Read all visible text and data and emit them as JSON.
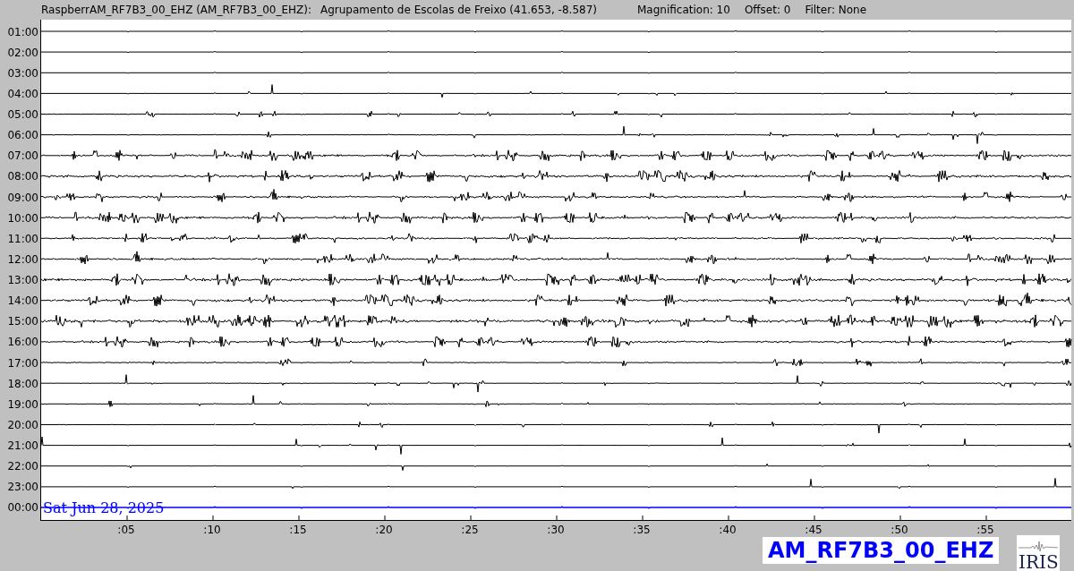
{
  "header": {
    "station": "RaspberrAM_RF7B3_00_EHZ (AM_RF7B3_00_EHZ):",
    "location": "Agrupamento de Escolas de Freixo (41.653, -8.587)",
    "magnification": "Magnification: 10",
    "offset": "Offset: 0",
    "filter": "Filter: None"
  },
  "helicorder": {
    "date": "Sat Jun 28, 2025",
    "rows": [
      {
        "label": "01:00",
        "current": false
      },
      {
        "label": "02:00",
        "current": false
      },
      {
        "label": "03:00",
        "current": false
      },
      {
        "label": "04:00",
        "current": false
      },
      {
        "label": "05:00",
        "current": false
      },
      {
        "label": "06:00",
        "current": false
      },
      {
        "label": "07:00",
        "current": false
      },
      {
        "label": "08:00",
        "current": false
      },
      {
        "label": "09:00",
        "current": false
      },
      {
        "label": "10:00",
        "current": false
      },
      {
        "label": "11:00",
        "current": false
      },
      {
        "label": "12:00",
        "current": false
      },
      {
        "label": "13:00",
        "current": false
      },
      {
        "label": "14:00",
        "current": false
      },
      {
        "label": "15:00",
        "current": false
      },
      {
        "label": "16:00",
        "current": false
      },
      {
        "label": "17:00",
        "current": false
      },
      {
        "label": "18:00",
        "current": false
      },
      {
        "label": "19:00",
        "current": false
      },
      {
        "label": "20:00",
        "current": false
      },
      {
        "label": "21:00",
        "current": false
      },
      {
        "label": "22:00",
        "current": false
      },
      {
        "label": "23:00",
        "current": false
      },
      {
        "label": "00:00",
        "current": true
      }
    ],
    "minute_ticks": [
      ":05",
      ":10",
      ":15",
      ":20",
      ":25",
      ":30",
      ":35",
      ":40",
      ":45",
      ":50",
      ":55"
    ]
  },
  "footer": {
    "channel": "AM_RF7B3_00_EHZ",
    "logo_text": "IRIS"
  }
}
